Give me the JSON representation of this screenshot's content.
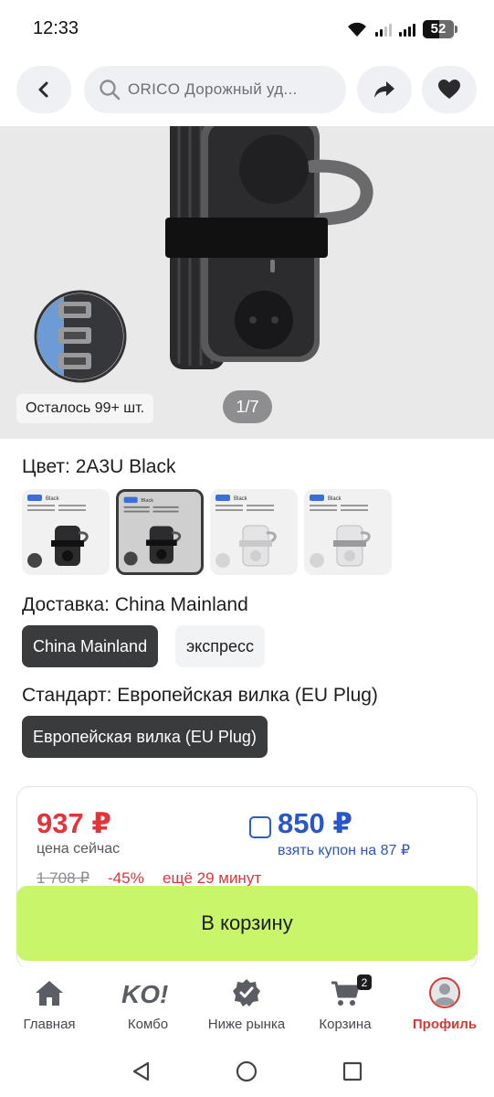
{
  "status_bar": {
    "time": "12:33",
    "battery": "52"
  },
  "header": {
    "search_text": "ORICO  Дорожный уд...",
    "icons": [
      "back-arrow-icon",
      "search-icon",
      "share-icon",
      "heart-icon"
    ]
  },
  "gallery": {
    "stock_label": "Осталось 99+ шт.",
    "page_indicator": "1/7"
  },
  "color": {
    "title": "Цвет: 2A3U Black",
    "swatches": [
      {
        "tag": "Black",
        "variant": "black",
        "selected": false
      },
      {
        "tag": "Black",
        "variant": "black",
        "selected": true
      },
      {
        "tag": "Black",
        "variant": "white",
        "selected": false
      },
      {
        "tag": "Black",
        "variant": "white",
        "selected": false
      }
    ]
  },
  "delivery": {
    "title": "Доставка: China Mainland",
    "options": [
      {
        "label": "China Mainland",
        "selected": true
      },
      {
        "label": "экспресс",
        "selected": false
      }
    ]
  },
  "standard": {
    "title": "Стандарт: Европейская вилка (EU Plug)",
    "options": [
      {
        "label": "Европейская вилка (EU Plug)",
        "selected": true
      }
    ]
  },
  "price": {
    "current": "937 ₽",
    "current_label": "цена сейчас",
    "coupon_price": "850 ₽",
    "coupon_label": "взять купон на 87 ₽",
    "old_price": "1 708 ₽",
    "discount": "-45%",
    "timer": "ещё 29 минут"
  },
  "actions": {
    "add_to_cart": "В корзину"
  },
  "bottom_nav": {
    "items": [
      {
        "label": "Главная",
        "icon": "home-icon"
      },
      {
        "label": "Комбо",
        "icon": "ko-logo-icon"
      },
      {
        "label": "Ниже рынка",
        "icon": "verified-badge-icon"
      },
      {
        "label": "Корзина",
        "icon": "cart-icon",
        "badge": "2"
      },
      {
        "label": "Профиль",
        "icon": "profile-icon",
        "active": true
      }
    ]
  },
  "colors": {
    "accent_red": "#e2343a",
    "coupon_blue": "#2b56c7",
    "cart_button": "#c9f56b",
    "selected_chip": "#3a3b3d"
  }
}
